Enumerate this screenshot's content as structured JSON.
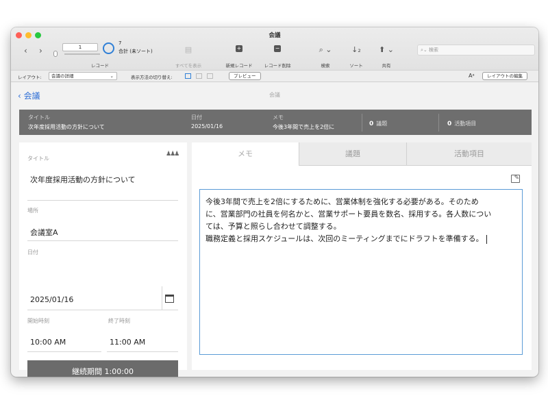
{
  "window": {
    "title": "会議"
  },
  "toolbar": {
    "record_field_value": "1",
    "record_label": "レコード",
    "record_count": "7",
    "record_status": "合計 (未ソート)",
    "show_all_label": "すべてを表示",
    "new_record_label": "新規レコード",
    "delete_record_label": "レコード削除",
    "find_label": "検索",
    "sort_label": "ソート",
    "share_label": "共有",
    "search_placeholder": "検索"
  },
  "layout_bar": {
    "layout_label": "レイアウト:",
    "layout_value": "会議の詳細",
    "view_as_label": "表示方法の切り替え:",
    "preview_label": "プレビュー",
    "text_size_glyph": "Aᵃ",
    "edit_layout_label": "レイアウトの編集"
  },
  "navbar": {
    "back_label": "会議",
    "title": "会議"
  },
  "summary": {
    "title_label": "タイトル",
    "title_value": "次年度採用活動の方針について",
    "date_label": "日付",
    "date_value": "2025/01/16",
    "memo_label": "メモ",
    "memo_value": "今後3年間で売上を2倍に",
    "agenda_count": "0",
    "agenda_label": "議題",
    "action_count": "0",
    "action_label": "活動項目"
  },
  "form": {
    "title_label": "タイトル",
    "title_value": "次年度採用活動の方針について",
    "location_label": "場所",
    "location_value": "会議室A",
    "date_label": "日付",
    "date_value": "2025/01/16",
    "start_label": "開始時刻",
    "start_value": "10:00 AM",
    "end_label": "終了時刻",
    "end_value": "11:00 AM",
    "duration_label": "継続期間 1:00:00"
  },
  "tabs": [
    {
      "label": "メモ"
    },
    {
      "label": "議題"
    },
    {
      "label": "活動項目"
    }
  ],
  "memo": {
    "lines": [
      "今後3年間で売上を2倍にするために、営業体制を強化する必要がある。そのため",
      "に、営業部門の社員を何名かと、営業サポート要員を数名、採用する。各人数につい",
      "ては、予算と照らし合わせて調整する。",
      "職務定義と採用スケジュールは、次回のミーティングまでにドラフトを準備する。"
    ]
  },
  "icons": {
    "team": "team-icon",
    "calendar": "calendar-icon",
    "edit": "edit-icon",
    "search": "search-icon"
  },
  "colors": {
    "accent": "#2f7fd6",
    "summary_bg": "#6e6e6e",
    "duration_bg": "#6b6b6b"
  }
}
